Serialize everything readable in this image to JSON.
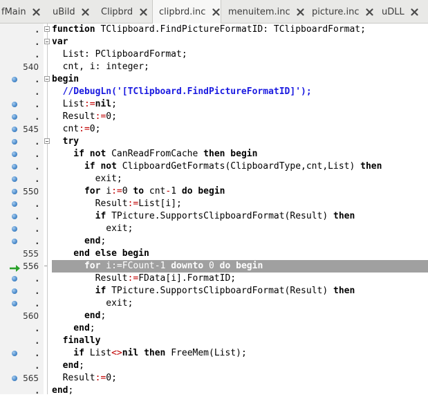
{
  "tabs": [
    {
      "label": "fMain"
    },
    {
      "label": "uBild"
    },
    {
      "label": "Clipbrd"
    },
    {
      "label": "clipbrd.inc",
      "active": true
    },
    {
      "label": "menuitem.inc"
    },
    {
      "label": "picture.inc"
    },
    {
      "label": "uDLL"
    }
  ],
  "lines": [
    {
      "gutter": ".",
      "fold": "box",
      "code": [
        [
          "kw",
          "function"
        ],
        [
          "t",
          " TClipboard.FindPictureFormatID: TClipboardFormat;"
        ]
      ]
    },
    {
      "gutter": ".",
      "fold": "box",
      "code": [
        [
          "kw",
          "var"
        ]
      ]
    },
    {
      "gutter": ".",
      "code": [
        [
          "t",
          "  List: PClipboardFormat;"
        ]
      ]
    },
    {
      "gutter": "540",
      "code": [
        [
          "t",
          "  cnt, i: integer;"
        ]
      ]
    },
    {
      "gutter": ".",
      "dot": true,
      "fold": "box",
      "code": [
        [
          "kw",
          "begin"
        ]
      ]
    },
    {
      "gutter": ".",
      "code": [
        [
          "cmt",
          "  //DebugLn('[TClipboard.FindPictureFormatID]');"
        ]
      ]
    },
    {
      "gutter": ".",
      "dot": true,
      "code": [
        [
          "t",
          "  List"
        ],
        [
          "sym",
          ":="
        ],
        [
          "kw",
          "nil"
        ],
        [
          "t",
          ";"
        ]
      ]
    },
    {
      "gutter": ".",
      "dot": true,
      "code": [
        [
          "t",
          "  Result"
        ],
        [
          "sym",
          ":="
        ],
        [
          "t",
          "0;"
        ]
      ]
    },
    {
      "gutter": "545",
      "dot": true,
      "code": [
        [
          "t",
          "  cnt"
        ],
        [
          "sym",
          ":="
        ],
        [
          "t",
          "0;"
        ]
      ]
    },
    {
      "gutter": ".",
      "dot": true,
      "fold": "box",
      "code": [
        [
          "kw",
          "  try"
        ]
      ]
    },
    {
      "gutter": ".",
      "dot": true,
      "code": [
        [
          "kw",
          "    if not"
        ],
        [
          "t",
          " CanReadFromCache "
        ],
        [
          "kw",
          "then begin"
        ]
      ]
    },
    {
      "gutter": ".",
      "dot": true,
      "code": [
        [
          "kw",
          "      if not"
        ],
        [
          "t",
          " ClipboardGetFormats(ClipboardType,cnt,List) "
        ],
        [
          "kw",
          "then"
        ]
      ]
    },
    {
      "gutter": ".",
      "dot": true,
      "code": [
        [
          "t",
          "        exit;"
        ]
      ]
    },
    {
      "gutter": "550",
      "dot": true,
      "code": [
        [
          "kw",
          "      for"
        ],
        [
          "t",
          " i"
        ],
        [
          "sym",
          ":="
        ],
        [
          "t",
          "0 "
        ],
        [
          "kw",
          "to"
        ],
        [
          "t",
          " cnt"
        ],
        [
          "sym",
          "-"
        ],
        [
          "t",
          "1 "
        ],
        [
          "kw",
          "do begin"
        ]
      ]
    },
    {
      "gutter": ".",
      "dot": true,
      "code": [
        [
          "t",
          "        Result"
        ],
        [
          "sym",
          ":="
        ],
        [
          "t",
          "List[i];"
        ]
      ]
    },
    {
      "gutter": ".",
      "dot": true,
      "code": [
        [
          "kw",
          "        if"
        ],
        [
          "t",
          " TPicture.SupportsClipboardFormat(Result) "
        ],
        [
          "kw",
          "then"
        ]
      ]
    },
    {
      "gutter": ".",
      "dot": true,
      "code": [
        [
          "t",
          "          exit;"
        ]
      ]
    },
    {
      "gutter": ".",
      "dot": true,
      "code": [
        [
          "kw",
          "      end"
        ],
        [
          "t",
          ";"
        ]
      ]
    },
    {
      "gutter": "555",
      "code": [
        [
          "kw",
          "    end else begin"
        ]
      ]
    },
    {
      "gutter": "556",
      "arrow": true,
      "exec": true,
      "fold": "tick",
      "code": [
        [
          "kw",
          "      for"
        ],
        [
          "t",
          " i"
        ],
        [
          "sym",
          ":="
        ],
        [
          "t",
          "FCount"
        ],
        [
          "sym",
          "-"
        ],
        [
          "t",
          "1 "
        ],
        [
          "kw",
          "downto"
        ],
        [
          "t",
          " 0 "
        ],
        [
          "kw",
          "do begin"
        ]
      ]
    },
    {
      "gutter": ".",
      "dot": true,
      "code": [
        [
          "t",
          "        Result"
        ],
        [
          "sym",
          ":="
        ],
        [
          "t",
          "FData[i].FormatID;"
        ]
      ]
    },
    {
      "gutter": ".",
      "dot": true,
      "code": [
        [
          "kw",
          "        if"
        ],
        [
          "t",
          " TPicture.SupportsClipboardFormat(Result) "
        ],
        [
          "kw",
          "then"
        ]
      ]
    },
    {
      "gutter": ".",
      "dot": true,
      "code": [
        [
          "t",
          "          exit;"
        ]
      ]
    },
    {
      "gutter": "560",
      "code": [
        [
          "kw",
          "      end"
        ],
        [
          "t",
          ";"
        ]
      ]
    },
    {
      "gutter": ".",
      "code": [
        [
          "kw",
          "    end"
        ],
        [
          "t",
          ";"
        ]
      ]
    },
    {
      "gutter": ".",
      "code": [
        [
          "kw",
          "  finally"
        ]
      ]
    },
    {
      "gutter": ".",
      "dot": true,
      "code": [
        [
          "kw",
          "    if"
        ],
        [
          "t",
          " List"
        ],
        [
          "sym",
          "<>"
        ],
        [
          "kw",
          "nil then"
        ],
        [
          "t",
          " FreeMem(List);"
        ]
      ]
    },
    {
      "gutter": ".",
      "code": [
        [
          "kw",
          "  end"
        ],
        [
          "t",
          ";"
        ]
      ]
    },
    {
      "gutter": "565",
      "dot": true,
      "code": [
        [
          "t",
          "  Result"
        ],
        [
          "sym",
          ":="
        ],
        [
          "t",
          "0;"
        ]
      ]
    },
    {
      "gutter": ".",
      "code": [
        [
          "kw",
          "end"
        ],
        [
          "t",
          ";"
        ]
      ]
    }
  ],
  "colors": {
    "exec_line": "#a0a0a0",
    "breakpoint_dot": "#4f8fcf",
    "exec_arrow": "#2aa12a",
    "comment": "#1a1ae0",
    "symbol": "#c00000"
  }
}
